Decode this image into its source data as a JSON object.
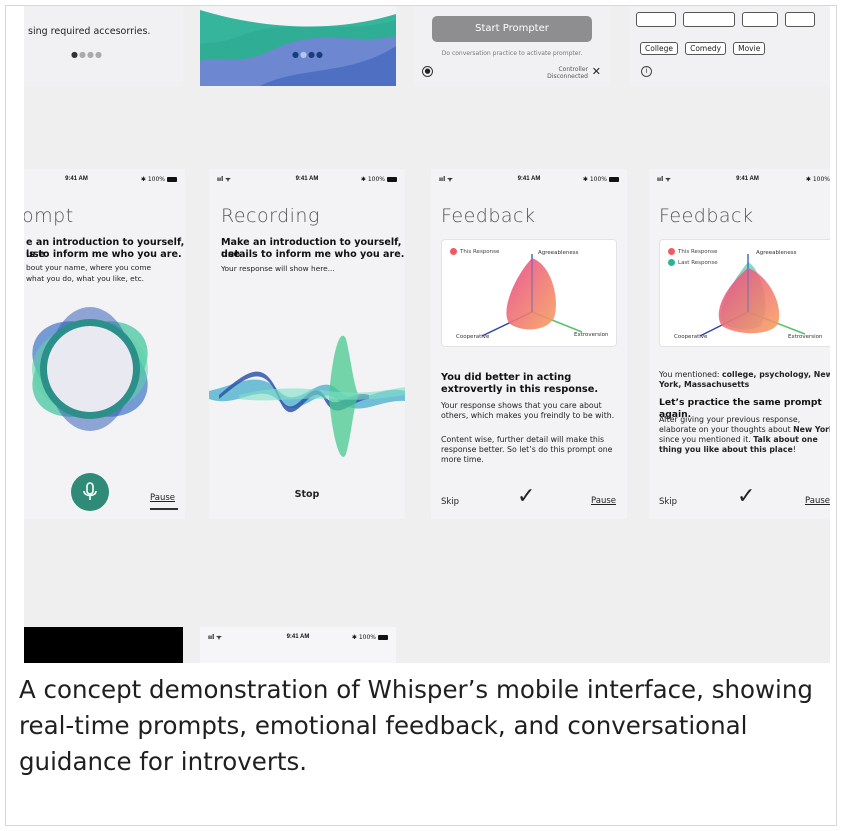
{
  "status": {
    "time": "9:41 AM",
    "signal": "ııl ᯤ",
    "battery": "100%"
  },
  "top_row": {
    "screen1_text": "sing required accesorries.",
    "screen3_button": "Start Prompter",
    "screen3_hint": "Do conversation practice  to activate prompter.",
    "screen3_controller_line1": "Controller",
    "screen3_controller_line2": "Disconnected",
    "screen4_tags": [
      "College",
      "Comedy",
      "Movie"
    ]
  },
  "prompt_screen": {
    "title": "ompt",
    "bold_line1": "e an introduction to yourself, use",
    "bold_line2": "ls to inform me who you are.",
    "small_line1": "bout your name, where you come",
    "small_line2": "what you do, what you like, etc.",
    "pause_label": "Pause"
  },
  "recording_screen": {
    "title": "Recording",
    "bold_line1": "Make an introduction to yourself, use",
    "bold_line2": "details to inform me who you are.",
    "small_line": "Your response will show here...",
    "stop_label": "Stop"
  },
  "feedback1": {
    "title": "Feedback",
    "legend_this": "This Response",
    "axis_top": "Agreeableness",
    "axis_left": "Cooperative",
    "axis_right": "Extroversion",
    "headline": "You did better in acting extrovertly in this response.",
    "para1": "Your response shows that you care about others, which makes you freindly to be with.",
    "para2": "Content wise, further detail will make this response better. So let’s do this prompt one more time.",
    "skip_label": "Skip",
    "pause_label": "Pause"
  },
  "feedback2": {
    "title": "Feedback",
    "legend_this": "This Response",
    "legend_last": "Last Response",
    "axis_top": "Agreeableness",
    "axis_left": "Cooperative",
    "axis_right": "Extroversion",
    "mention_prefix": "You mentioned: ",
    "mention_bold": "college, psychology, New York, Massachusetts",
    "headline": "Let’s practice the same prompt again.",
    "para_prefix": "After giving your previous response, elaborate on your thoughts about ",
    "para_bold1": "New York",
    "para_mid": " since you mentioned it.  ",
    "para_bold2": "Talk about one thing you like about this place",
    "para_end": "!",
    "skip_label": "Skip",
    "pause_label": "Pause"
  },
  "caption": "A concept demonstration of Whisper’s mobile interface, showing real-time prompts, emotional feedback, and conversational guidance for introverts.",
  "colors": {
    "canvas": "#efefef",
    "screen_bg": "#f3f3f6",
    "accent_teal": "#2f8a77",
    "this_response": "#ef5b62",
    "last_response": "#2bb39a"
  }
}
